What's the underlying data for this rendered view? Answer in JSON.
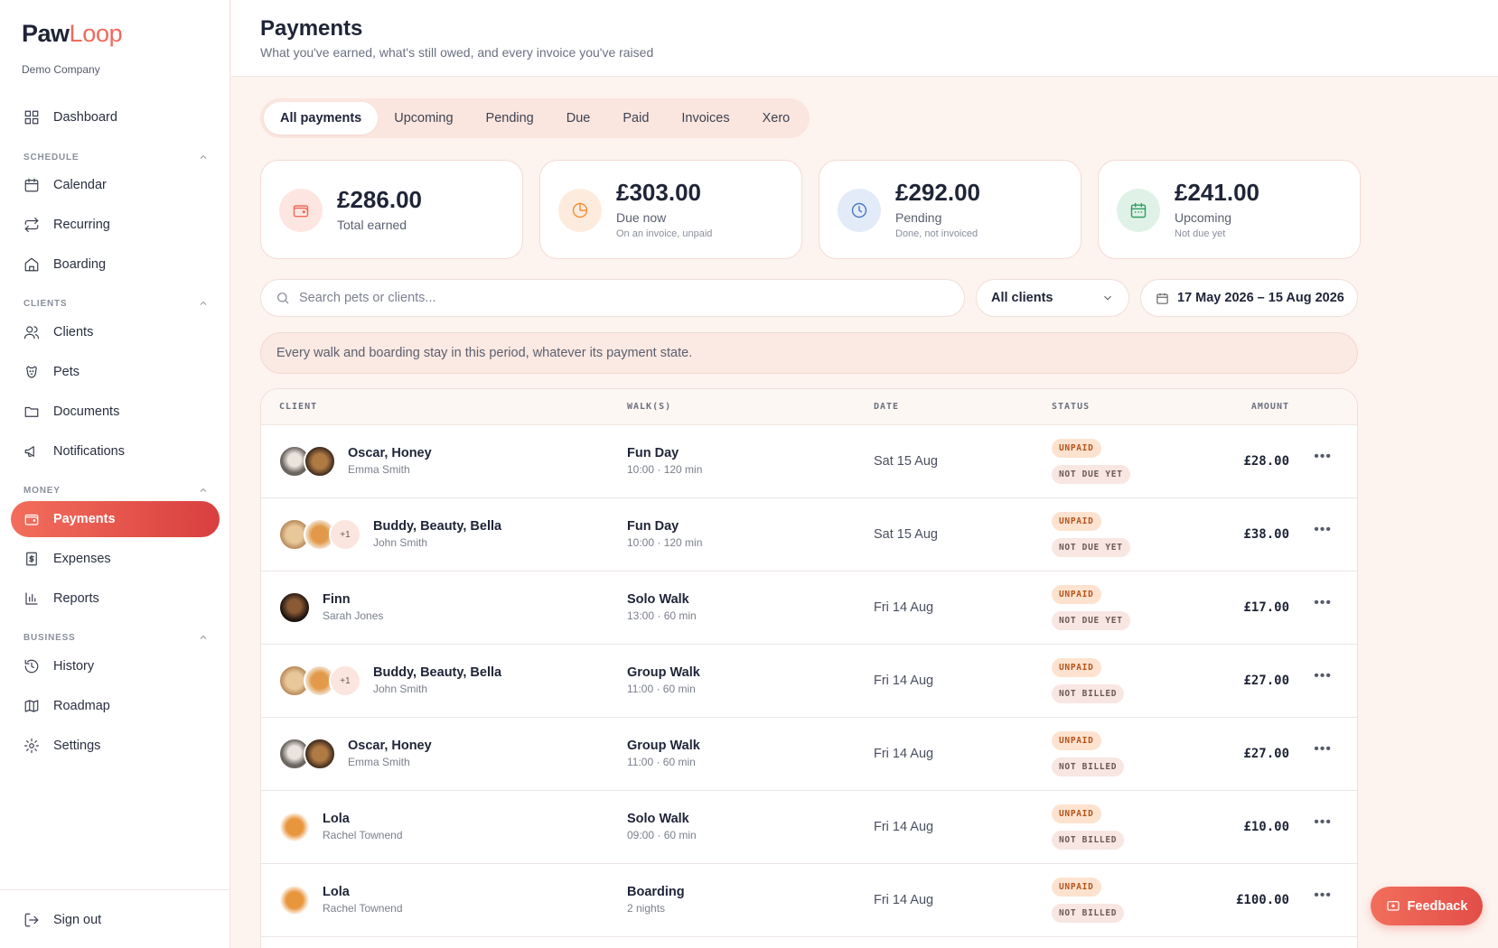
{
  "brand": {
    "name_part1": "Paw",
    "name_part2": "Loop",
    "company": "Demo Company"
  },
  "sidebar": {
    "dashboard": "Dashboard",
    "sections": {
      "schedule": "SCHEDULE",
      "clients": "CLIENTS",
      "money": "MONEY",
      "business": "BUSINESS"
    },
    "items": {
      "calendar": "Calendar",
      "recurring": "Recurring",
      "boarding": "Boarding",
      "clients": "Clients",
      "pets": "Pets",
      "documents": "Documents",
      "notifications": "Notifications",
      "payments": "Payments",
      "expenses": "Expenses",
      "reports": "Reports",
      "history": "History",
      "roadmap": "Roadmap",
      "settings": "Settings"
    },
    "sign_out": "Sign out"
  },
  "header": {
    "title": "Payments",
    "subtitle": "What you've earned, what's still owed, and every invoice you've raised"
  },
  "tabs": [
    "All payments",
    "Upcoming",
    "Pending",
    "Due",
    "Paid",
    "Invoices",
    "Xero"
  ],
  "stats": [
    {
      "amount": "£286.00",
      "label": "Total earned",
      "sub": "",
      "color": "#ef6a5b"
    },
    {
      "amount": "£303.00",
      "label": "Due now",
      "sub": "On an invoice, unpaid",
      "color": "#f0903a"
    },
    {
      "amount": "£292.00",
      "label": "Pending",
      "sub": "Done, not invoiced",
      "color": "#4a78c8"
    },
    {
      "amount": "£241.00",
      "label": "Upcoming",
      "sub": "Not due yet",
      "color": "#2f9e63"
    }
  ],
  "filters": {
    "search_placeholder": "Search pets or clients...",
    "client_select": "All clients",
    "date_range": "17 May 2026 – 15 Aug 2026"
  },
  "info": "Every walk and boarding stay in this period, whatever its payment state.",
  "table": {
    "headers": {
      "client": "CLIENT",
      "walks": "WALK(S)",
      "date": "DATE",
      "status": "STATUS",
      "amount": "AMOUNT"
    },
    "rows": [
      {
        "pets": "Oscar, Honey",
        "owner": "Emma Smith",
        "walk": "Fun Day",
        "time": "10:00 · 120 min",
        "date": "Sat 15 Aug",
        "status1": "UNPAID",
        "status2": "NOT DUE YET",
        "amount": "£28.00",
        "more": "•••"
      },
      {
        "pets": "Buddy, Beauty, Bella",
        "owner": "John Smith",
        "walk": "Fun Day",
        "time": "10:00 · 120 min",
        "date": "Sat 15 Aug",
        "status1": "UNPAID",
        "status2": "NOT DUE YET",
        "amount": "£38.00",
        "more": "•••",
        "extra": "+1"
      },
      {
        "pets": "Finn",
        "owner": "Sarah Jones",
        "walk": "Solo Walk",
        "time": "13:00 · 60 min",
        "date": "Fri 14 Aug",
        "status1": "UNPAID",
        "status2": "NOT DUE YET",
        "amount": "£17.00",
        "more": "•••"
      },
      {
        "pets": "Buddy, Beauty, Bella",
        "owner": "John Smith",
        "walk": "Group Walk",
        "time": "11:00 · 60 min",
        "date": "Fri 14 Aug",
        "status1": "UNPAID",
        "status2": "NOT BILLED",
        "amount": "£27.00",
        "more": "•••",
        "extra": "+1"
      },
      {
        "pets": "Oscar, Honey",
        "owner": "Emma Smith",
        "walk": "Group Walk",
        "time": "11:00 · 60 min",
        "date": "Fri 14 Aug",
        "status1": "UNPAID",
        "status2": "NOT BILLED",
        "amount": "£27.00",
        "more": "•••"
      },
      {
        "pets": "Lola",
        "owner": "Rachel Townend",
        "walk": "Solo Walk",
        "time": "09:00 · 60 min",
        "date": "Fri 14 Aug",
        "status1": "UNPAID",
        "status2": "NOT BILLED",
        "amount": "£10.00",
        "more": "•••"
      },
      {
        "pets": "Lola",
        "owner": "Rachel Townend",
        "walk": "Boarding",
        "time": "2 nights",
        "date": "Fri 14 Aug",
        "status1": "UNPAID",
        "status2": "NOT BILLED",
        "amount": "£100.00",
        "more": "•••"
      }
    ]
  },
  "feedback": "Feedback"
}
